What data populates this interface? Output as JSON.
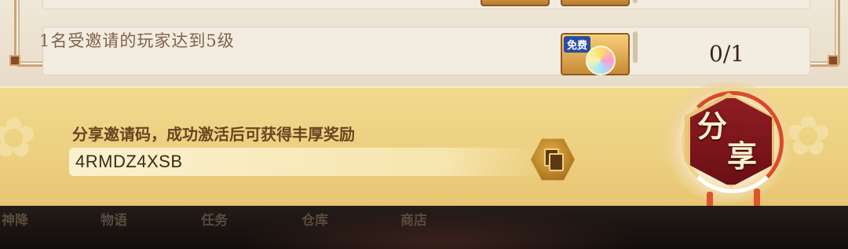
{
  "list": {
    "row_text": "1名受邀请的玩家达到5级",
    "reward_badge": "免费",
    "progress": "0/1"
  },
  "share_panel": {
    "prompt": "分享邀请码，成功激活后可获得丰厚奖励",
    "invite_code": "4RMDZ4XSB",
    "share_char_1": "分",
    "share_char_2": "享"
  },
  "nav": {
    "items": [
      "神降",
      "物语",
      "任务",
      "仓库",
      "商店"
    ]
  },
  "colors": {
    "panel_gold": "#eccf7f",
    "medal_red": "#8e1d22",
    "text_brown": "#6a4420"
  }
}
